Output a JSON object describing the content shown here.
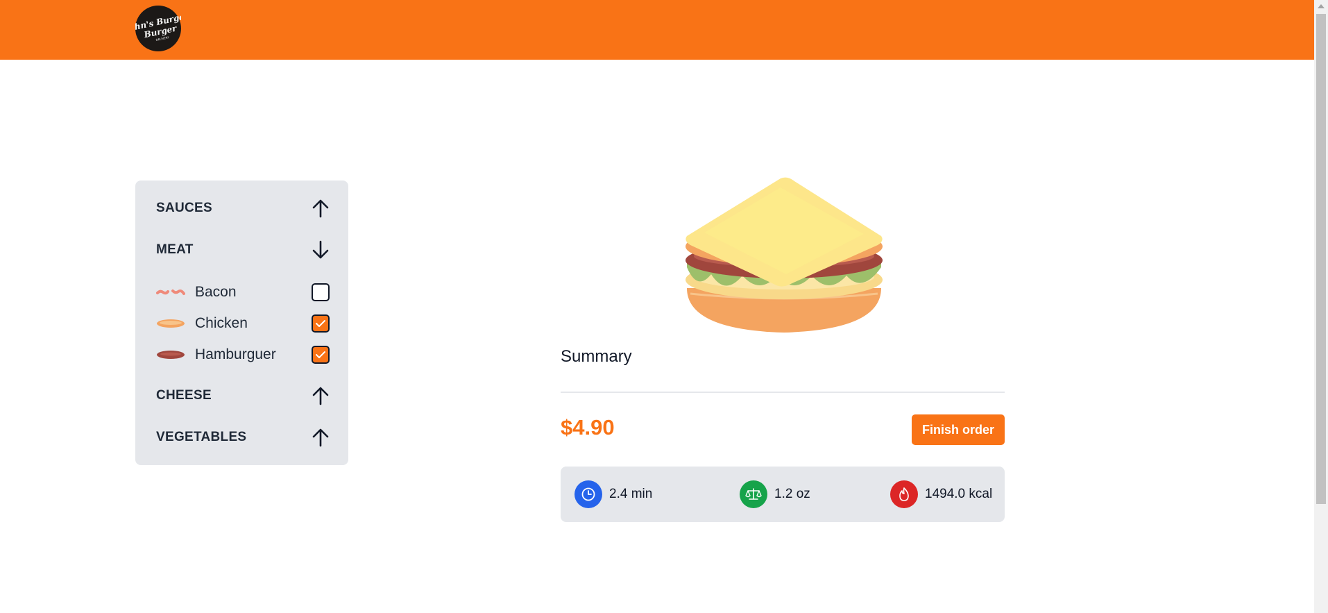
{
  "header": {
    "brand_color": "#f97316",
    "logo_text": "John's Burger",
    "logo_subtext": "DELIVERY"
  },
  "sidebar": {
    "categories": [
      {
        "label": "SAUCES",
        "expanded": false,
        "arrow": "arrow-up-icon"
      },
      {
        "label": "MEAT",
        "expanded": true,
        "arrow": "arrow-down-icon",
        "items": [
          {
            "label": "Bacon",
            "checked": false,
            "icon": "bacon-icon"
          },
          {
            "label": "Chicken",
            "checked": true,
            "icon": "chicken-icon"
          },
          {
            "label": "Hamburguer",
            "checked": true,
            "icon": "hamburger-patty-icon"
          }
        ]
      },
      {
        "label": "CHEESE",
        "expanded": false,
        "arrow": "arrow-up-icon"
      },
      {
        "label": "VEGETABLES",
        "expanded": false,
        "arrow": "arrow-up-icon"
      }
    ]
  },
  "summary": {
    "title": "Summary",
    "price": "$4.90",
    "finish_label": "Finish order",
    "stats": [
      {
        "value": "2.4 min",
        "icon": "clock-icon",
        "color": "#2563eb"
      },
      {
        "value": "1.2 oz",
        "icon": "scale-icon",
        "color": "#16a34a"
      },
      {
        "value": "1494.0 kcal",
        "icon": "flame-icon",
        "color": "#dc2626"
      }
    ]
  },
  "colors": {
    "accent": "#f97316",
    "panel": "#e5e7eb",
    "text": "#1f2937"
  }
}
